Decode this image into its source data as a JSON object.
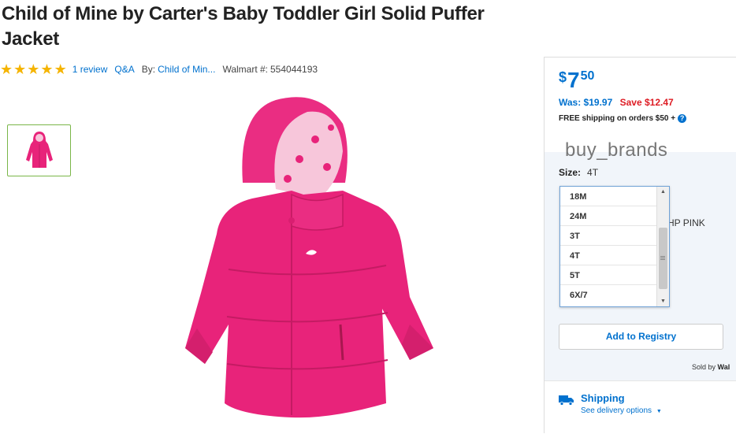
{
  "product": {
    "title": "Child of Mine by Carter's Baby Toddler Girl Solid Puffer Jacket",
    "rating_stars": 5,
    "reviews_link": "1 review",
    "qa_link": "Q&A",
    "by_label": "By:",
    "brand_link": "Child of Min...",
    "walmart_label": "Walmart #:",
    "walmart_number": "554044193"
  },
  "offer": {
    "currency": "$",
    "price_dollars": "7",
    "price_cents": "50",
    "was_text": "Was: $19.97",
    "save_text": "Save $12.47",
    "free_shipping": "FREE shipping on orders $50 +",
    "help_icon_glyph": "?"
  },
  "watermark": "buy_brands",
  "size": {
    "label": "Size:",
    "selected": "4T",
    "options": [
      "18M",
      "24M",
      "3T",
      "4T",
      "5T",
      "6X/7"
    ]
  },
  "color_partial": "HP PINK",
  "registry_button": "Add to Registry",
  "sold_by": {
    "label": "Sold by",
    "seller_partial": "Wal"
  },
  "shipping": {
    "title": "Shipping",
    "delivery_link": "See delivery options"
  },
  "colors": {
    "walmart_blue": "#0071ce",
    "save_red": "#de1c24",
    "star_yellow": "#f5b400",
    "thumb_border_green": "#7ab648",
    "jacket_pink": "#e8237a"
  }
}
